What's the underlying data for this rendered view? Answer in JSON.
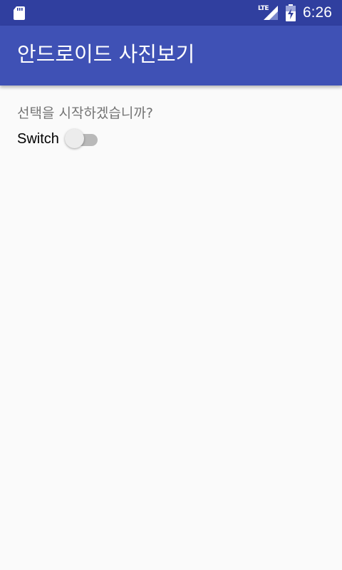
{
  "status_bar": {
    "network_label": "LTE",
    "time": "6:26",
    "background_color": "#303f9f",
    "icons": [
      "sd-card-icon",
      "lte-signal-icon",
      "battery-charging-icon"
    ]
  },
  "app_bar": {
    "title": "안드로이드 사진보기",
    "background_color": "#3f51b5"
  },
  "content": {
    "prompt": "선택을 시작하겠습니까?",
    "switch": {
      "label": "Switch",
      "checked": false
    }
  }
}
